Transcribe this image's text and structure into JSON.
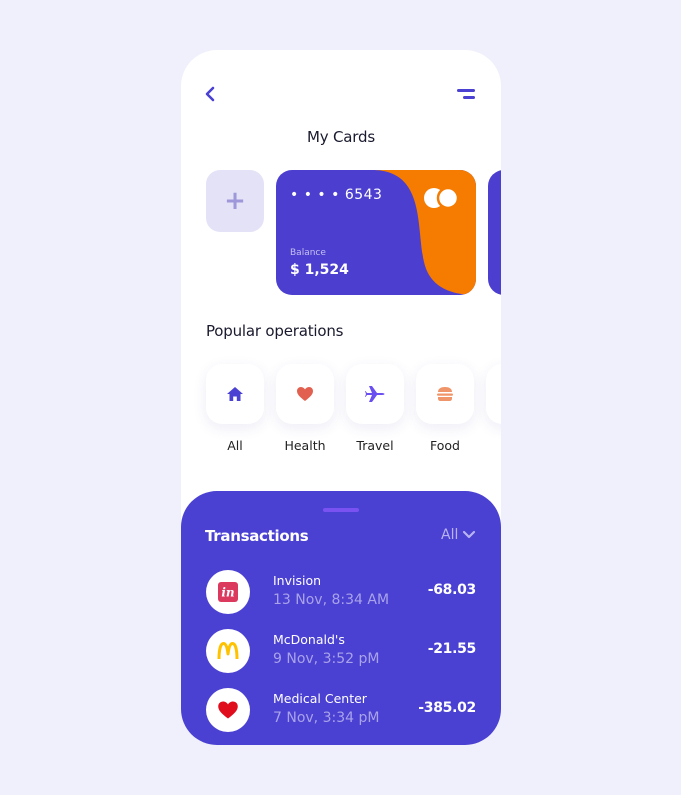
{
  "header": {
    "title": "My Cards",
    "back_icon": "chevron-left-icon",
    "menu_icon": "menu-icon"
  },
  "add_card": {
    "label": "+"
  },
  "card": {
    "number": "• • • • 6543",
    "balance_label": "Balance",
    "balance": "$ 1,524",
    "colors": {
      "primary": "#4c3fd0",
      "accent": "#f57c00"
    },
    "logo_icon": "card-network-logo"
  },
  "operations": {
    "title": "Popular operations",
    "items": [
      {
        "label": "All",
        "icon": "home-icon",
        "color": "#4a40d2"
      },
      {
        "label": "Health",
        "icon": "heart-icon",
        "color": "#e2604f"
      },
      {
        "label": "Travel",
        "icon": "plane-icon",
        "color": "#6b4ef0"
      },
      {
        "label": "Food",
        "icon": "burger-icon",
        "color": "#f0956a"
      }
    ]
  },
  "transactions": {
    "title": "Transactions",
    "filter": "All",
    "items": [
      {
        "name": "Invision",
        "date": "13 Nov, 8:34 AM",
        "amount": "-68.03",
        "icon": "invision-icon"
      },
      {
        "name": "McDonald's",
        "date": "9 Nov, 3:52 pM",
        "amount": "-21.55",
        "icon": "mcdonalds-icon"
      },
      {
        "name": "Medical Center",
        "date": "7 Nov, 3:34 pM",
        "amount": "-385.02",
        "icon": "heart-icon"
      }
    ]
  }
}
